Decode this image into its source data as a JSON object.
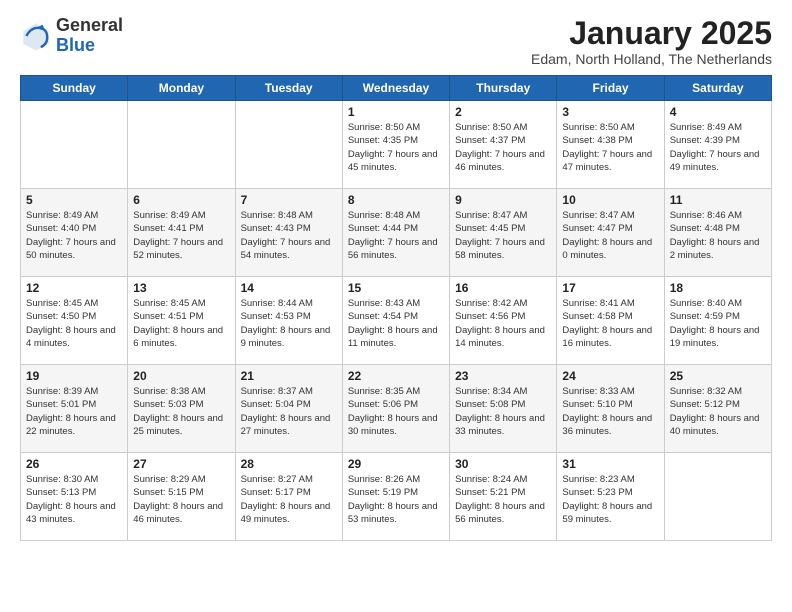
{
  "header": {
    "logo_general": "General",
    "logo_blue": "Blue",
    "month_title": "January 2025",
    "location": "Edam, North Holland, The Netherlands"
  },
  "weekdays": [
    "Sunday",
    "Monday",
    "Tuesday",
    "Wednesday",
    "Thursday",
    "Friday",
    "Saturday"
  ],
  "weeks": [
    [
      {
        "day": "",
        "text": ""
      },
      {
        "day": "",
        "text": ""
      },
      {
        "day": "",
        "text": ""
      },
      {
        "day": "1",
        "text": "Sunrise: 8:50 AM\nSunset: 4:35 PM\nDaylight: 7 hours and 45 minutes."
      },
      {
        "day": "2",
        "text": "Sunrise: 8:50 AM\nSunset: 4:37 PM\nDaylight: 7 hours and 46 minutes."
      },
      {
        "day": "3",
        "text": "Sunrise: 8:50 AM\nSunset: 4:38 PM\nDaylight: 7 hours and 47 minutes."
      },
      {
        "day": "4",
        "text": "Sunrise: 8:49 AM\nSunset: 4:39 PM\nDaylight: 7 hours and 49 minutes."
      }
    ],
    [
      {
        "day": "5",
        "text": "Sunrise: 8:49 AM\nSunset: 4:40 PM\nDaylight: 7 hours and 50 minutes."
      },
      {
        "day": "6",
        "text": "Sunrise: 8:49 AM\nSunset: 4:41 PM\nDaylight: 7 hours and 52 minutes."
      },
      {
        "day": "7",
        "text": "Sunrise: 8:48 AM\nSunset: 4:43 PM\nDaylight: 7 hours and 54 minutes."
      },
      {
        "day": "8",
        "text": "Sunrise: 8:48 AM\nSunset: 4:44 PM\nDaylight: 7 hours and 56 minutes."
      },
      {
        "day": "9",
        "text": "Sunrise: 8:47 AM\nSunset: 4:45 PM\nDaylight: 7 hours and 58 minutes."
      },
      {
        "day": "10",
        "text": "Sunrise: 8:47 AM\nSunset: 4:47 PM\nDaylight: 8 hours and 0 minutes."
      },
      {
        "day": "11",
        "text": "Sunrise: 8:46 AM\nSunset: 4:48 PM\nDaylight: 8 hours and 2 minutes."
      }
    ],
    [
      {
        "day": "12",
        "text": "Sunrise: 8:45 AM\nSunset: 4:50 PM\nDaylight: 8 hours and 4 minutes."
      },
      {
        "day": "13",
        "text": "Sunrise: 8:45 AM\nSunset: 4:51 PM\nDaylight: 8 hours and 6 minutes."
      },
      {
        "day": "14",
        "text": "Sunrise: 8:44 AM\nSunset: 4:53 PM\nDaylight: 8 hours and 9 minutes."
      },
      {
        "day": "15",
        "text": "Sunrise: 8:43 AM\nSunset: 4:54 PM\nDaylight: 8 hours and 11 minutes."
      },
      {
        "day": "16",
        "text": "Sunrise: 8:42 AM\nSunset: 4:56 PM\nDaylight: 8 hours and 14 minutes."
      },
      {
        "day": "17",
        "text": "Sunrise: 8:41 AM\nSunset: 4:58 PM\nDaylight: 8 hours and 16 minutes."
      },
      {
        "day": "18",
        "text": "Sunrise: 8:40 AM\nSunset: 4:59 PM\nDaylight: 8 hours and 19 minutes."
      }
    ],
    [
      {
        "day": "19",
        "text": "Sunrise: 8:39 AM\nSunset: 5:01 PM\nDaylight: 8 hours and 22 minutes."
      },
      {
        "day": "20",
        "text": "Sunrise: 8:38 AM\nSunset: 5:03 PM\nDaylight: 8 hours and 25 minutes."
      },
      {
        "day": "21",
        "text": "Sunrise: 8:37 AM\nSunset: 5:04 PM\nDaylight: 8 hours and 27 minutes."
      },
      {
        "day": "22",
        "text": "Sunrise: 8:35 AM\nSunset: 5:06 PM\nDaylight: 8 hours and 30 minutes."
      },
      {
        "day": "23",
        "text": "Sunrise: 8:34 AM\nSunset: 5:08 PM\nDaylight: 8 hours and 33 minutes."
      },
      {
        "day": "24",
        "text": "Sunrise: 8:33 AM\nSunset: 5:10 PM\nDaylight: 8 hours and 36 minutes."
      },
      {
        "day": "25",
        "text": "Sunrise: 8:32 AM\nSunset: 5:12 PM\nDaylight: 8 hours and 40 minutes."
      }
    ],
    [
      {
        "day": "26",
        "text": "Sunrise: 8:30 AM\nSunset: 5:13 PM\nDaylight: 8 hours and 43 minutes."
      },
      {
        "day": "27",
        "text": "Sunrise: 8:29 AM\nSunset: 5:15 PM\nDaylight: 8 hours and 46 minutes."
      },
      {
        "day": "28",
        "text": "Sunrise: 8:27 AM\nSunset: 5:17 PM\nDaylight: 8 hours and 49 minutes."
      },
      {
        "day": "29",
        "text": "Sunrise: 8:26 AM\nSunset: 5:19 PM\nDaylight: 8 hours and 53 minutes."
      },
      {
        "day": "30",
        "text": "Sunrise: 8:24 AM\nSunset: 5:21 PM\nDaylight: 8 hours and 56 minutes."
      },
      {
        "day": "31",
        "text": "Sunrise: 8:23 AM\nSunset: 5:23 PM\nDaylight: 8 hours and 59 minutes."
      },
      {
        "day": "",
        "text": ""
      }
    ]
  ]
}
